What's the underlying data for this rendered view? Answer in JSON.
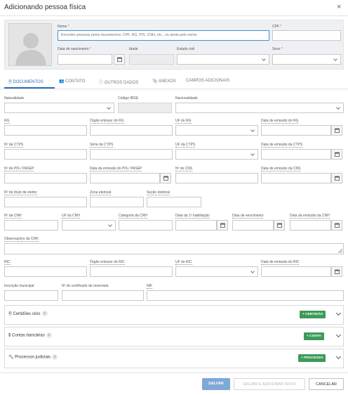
{
  "dialog": {
    "title": "Adicionando pessoa física",
    "close": "×"
  },
  "top": {
    "nome_label": "Nome",
    "nome_placeholder": "Encontre pessoas pelos documentos: CPF, RG, PIS, CNH, etc., ou ainda pelo nome.",
    "cpf_label": "CPF",
    "nascimento_label": "Data de nascimento",
    "idade_label": "Idade",
    "estado_civil_label": "Estado civil",
    "sexo_label": "Sexo",
    "required_mark": "*"
  },
  "tabs": [
    {
      "label": "DOCUMENTOS",
      "icon": "document-icon",
      "active": true
    },
    {
      "label": "CONTATO",
      "icon": "contact-icon"
    },
    {
      "label": "OUTROS DADOS",
      "icon": "info-icon"
    },
    {
      "label": "ANEXOS",
      "icon": "paperclip-icon"
    },
    {
      "label": "CAMPOS ADICIONAIS"
    }
  ],
  "docs": {
    "naturalidade": "Naturalidade",
    "codigo_ibge": "Código IBGE",
    "nacionalidade": "Nacionalidade",
    "rg": "RG",
    "orgao_rg": "Órgão emissor do RG",
    "uf_rg": "UF do RG",
    "data_rg": "Data de emissão do RG",
    "ctps": "Nº da CTPS",
    "serie_ctps": "Série da CTPS",
    "uf_ctps": "UF da CTPS",
    "data_ctps": "Data de emissão da CTPS",
    "pis": "Nº do PIS / PASEP",
    "data_pis": "Data da emissão do PIS / PASEP",
    "cns": "Nº do CNS",
    "data_cns": "Data de emissão da CNS",
    "titulo": "Nº do título de eleitor",
    "zona": "Zona eleitoral",
    "secao": "Seção eleitoral",
    "cnh": "Nº da CNH",
    "uf_cnh": "UF da CNH",
    "categoria_cnh": "Categoria da CNH",
    "primeira_hab": "Data da 1ª habilitação",
    "vencimento": "Data de vencimento",
    "emissao_cnh": "Data da emissão da CNH",
    "obs_cnh": "Observações da CNH",
    "ric": "RIC",
    "orgao_ric": "Órgão emissor do RIC",
    "uf_ric": "UF do RIC",
    "data_ric": "Data de emissão do RIC",
    "inscricao": "Inscrição municipal",
    "reservista": "Nº do certificado de reservista",
    "nif": "NIF"
  },
  "sections": [
    {
      "title": "Certidões civis",
      "count": "0",
      "button": "+ CERTIDÃO",
      "icon": "document-icon"
    },
    {
      "title": "Contas bancárias",
      "count": "0",
      "button": "+ CONTA",
      "icon": "dollar-icon"
    },
    {
      "title": "Processos judiciais",
      "count": "0",
      "button": "+ PROCESSO",
      "icon": "gavel-icon"
    }
  ],
  "footer": {
    "save": "SALVAR",
    "save_new": "SALVAR E ADICIONAR NOVO",
    "cancel": "CANCELAR"
  },
  "colors": {
    "accent": "#2a6ebb",
    "green": "#3e9a5a",
    "required": "#d9534f",
    "save_button": "#7fa8d8"
  }
}
